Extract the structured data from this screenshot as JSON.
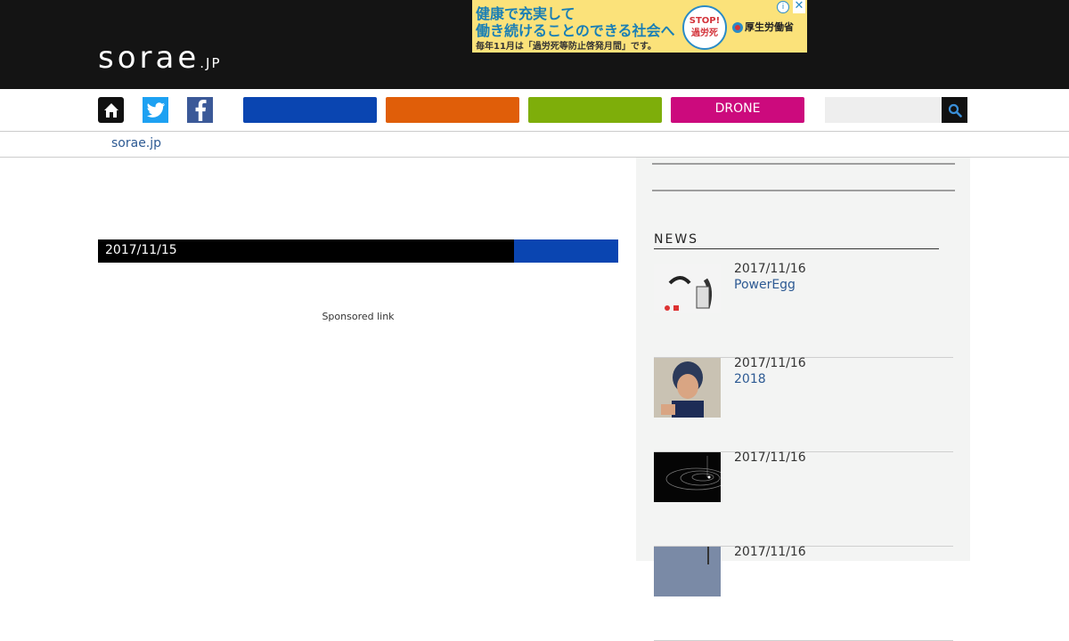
{
  "header": {
    "logo_main": "sorae",
    "logo_sub": ".JP",
    "ad": {
      "line1": "健康で充実して",
      "line2": "働き続けることのできる社会へ",
      "line3": "毎年11月は「過労死等防止啓発月間」です。",
      "stop_top": "STOP!",
      "stop_bottom": "過労死",
      "ministry": "厚生労働省",
      "info": "i",
      "close": "✕"
    }
  },
  "nav": {
    "buttons": [
      "",
      "",
      "",
      "DRONE"
    ],
    "colors": {
      "blue": "#0a45b1",
      "orange": "#e05e09",
      "green": "#7eae0a",
      "drone": "#cc0a7d"
    },
    "search_placeholder": ""
  },
  "breadcrumb": "sorae.jp",
  "article": {
    "date": "2017/11/15",
    "sponsored": "Sponsored link"
  },
  "sidebar": {
    "news_heading": "NEWS",
    "items": [
      {
        "date": "2017/11/16",
        "title": "PowerEgg"
      },
      {
        "date": "2017/11/16",
        "title": "2018"
      },
      {
        "date": "2017/11/16",
        "title": ""
      },
      {
        "date": "2017/11/16",
        "title": ""
      }
    ]
  }
}
